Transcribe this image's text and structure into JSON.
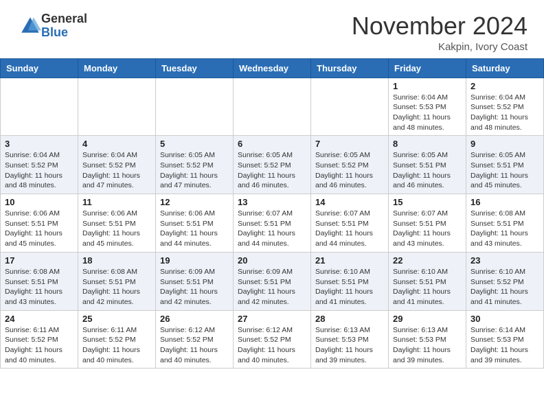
{
  "header": {
    "logo_general": "General",
    "logo_blue": "Blue",
    "month_title": "November 2024",
    "location": "Kakpin, Ivory Coast"
  },
  "days_of_week": [
    "Sunday",
    "Monday",
    "Tuesday",
    "Wednesday",
    "Thursday",
    "Friday",
    "Saturday"
  ],
  "weeks": [
    [
      {
        "day": "",
        "info": ""
      },
      {
        "day": "",
        "info": ""
      },
      {
        "day": "",
        "info": ""
      },
      {
        "day": "",
        "info": ""
      },
      {
        "day": "",
        "info": ""
      },
      {
        "day": "1",
        "info": "Sunrise: 6:04 AM\nSunset: 5:53 PM\nDaylight: 11 hours\nand 48 minutes."
      },
      {
        "day": "2",
        "info": "Sunrise: 6:04 AM\nSunset: 5:52 PM\nDaylight: 11 hours\nand 48 minutes."
      }
    ],
    [
      {
        "day": "3",
        "info": "Sunrise: 6:04 AM\nSunset: 5:52 PM\nDaylight: 11 hours\nand 48 minutes."
      },
      {
        "day": "4",
        "info": "Sunrise: 6:04 AM\nSunset: 5:52 PM\nDaylight: 11 hours\nand 47 minutes."
      },
      {
        "day": "5",
        "info": "Sunrise: 6:05 AM\nSunset: 5:52 PM\nDaylight: 11 hours\nand 47 minutes."
      },
      {
        "day": "6",
        "info": "Sunrise: 6:05 AM\nSunset: 5:52 PM\nDaylight: 11 hours\nand 46 minutes."
      },
      {
        "day": "7",
        "info": "Sunrise: 6:05 AM\nSunset: 5:52 PM\nDaylight: 11 hours\nand 46 minutes."
      },
      {
        "day": "8",
        "info": "Sunrise: 6:05 AM\nSunset: 5:51 PM\nDaylight: 11 hours\nand 46 minutes."
      },
      {
        "day": "9",
        "info": "Sunrise: 6:05 AM\nSunset: 5:51 PM\nDaylight: 11 hours\nand 45 minutes."
      }
    ],
    [
      {
        "day": "10",
        "info": "Sunrise: 6:06 AM\nSunset: 5:51 PM\nDaylight: 11 hours\nand 45 minutes."
      },
      {
        "day": "11",
        "info": "Sunrise: 6:06 AM\nSunset: 5:51 PM\nDaylight: 11 hours\nand 45 minutes."
      },
      {
        "day": "12",
        "info": "Sunrise: 6:06 AM\nSunset: 5:51 PM\nDaylight: 11 hours\nand 44 minutes."
      },
      {
        "day": "13",
        "info": "Sunrise: 6:07 AM\nSunset: 5:51 PM\nDaylight: 11 hours\nand 44 minutes."
      },
      {
        "day": "14",
        "info": "Sunrise: 6:07 AM\nSunset: 5:51 PM\nDaylight: 11 hours\nand 44 minutes."
      },
      {
        "day": "15",
        "info": "Sunrise: 6:07 AM\nSunset: 5:51 PM\nDaylight: 11 hours\nand 43 minutes."
      },
      {
        "day": "16",
        "info": "Sunrise: 6:08 AM\nSunset: 5:51 PM\nDaylight: 11 hours\nand 43 minutes."
      }
    ],
    [
      {
        "day": "17",
        "info": "Sunrise: 6:08 AM\nSunset: 5:51 PM\nDaylight: 11 hours\nand 43 minutes."
      },
      {
        "day": "18",
        "info": "Sunrise: 6:08 AM\nSunset: 5:51 PM\nDaylight: 11 hours\nand 42 minutes."
      },
      {
        "day": "19",
        "info": "Sunrise: 6:09 AM\nSunset: 5:51 PM\nDaylight: 11 hours\nand 42 minutes."
      },
      {
        "day": "20",
        "info": "Sunrise: 6:09 AM\nSunset: 5:51 PM\nDaylight: 11 hours\nand 42 minutes."
      },
      {
        "day": "21",
        "info": "Sunrise: 6:10 AM\nSunset: 5:51 PM\nDaylight: 11 hours\nand 41 minutes."
      },
      {
        "day": "22",
        "info": "Sunrise: 6:10 AM\nSunset: 5:51 PM\nDaylight: 11 hours\nand 41 minutes."
      },
      {
        "day": "23",
        "info": "Sunrise: 6:10 AM\nSunset: 5:52 PM\nDaylight: 11 hours\nand 41 minutes."
      }
    ],
    [
      {
        "day": "24",
        "info": "Sunrise: 6:11 AM\nSunset: 5:52 PM\nDaylight: 11 hours\nand 40 minutes."
      },
      {
        "day": "25",
        "info": "Sunrise: 6:11 AM\nSunset: 5:52 PM\nDaylight: 11 hours\nand 40 minutes."
      },
      {
        "day": "26",
        "info": "Sunrise: 6:12 AM\nSunset: 5:52 PM\nDaylight: 11 hours\nand 40 minutes."
      },
      {
        "day": "27",
        "info": "Sunrise: 6:12 AM\nSunset: 5:52 PM\nDaylight: 11 hours\nand 40 minutes."
      },
      {
        "day": "28",
        "info": "Sunrise: 6:13 AM\nSunset: 5:53 PM\nDaylight: 11 hours\nand 39 minutes."
      },
      {
        "day": "29",
        "info": "Sunrise: 6:13 AM\nSunset: 5:53 PM\nDaylight: 11 hours\nand 39 minutes."
      },
      {
        "day": "30",
        "info": "Sunrise: 6:14 AM\nSunset: 5:53 PM\nDaylight: 11 hours\nand 39 minutes."
      }
    ]
  ]
}
